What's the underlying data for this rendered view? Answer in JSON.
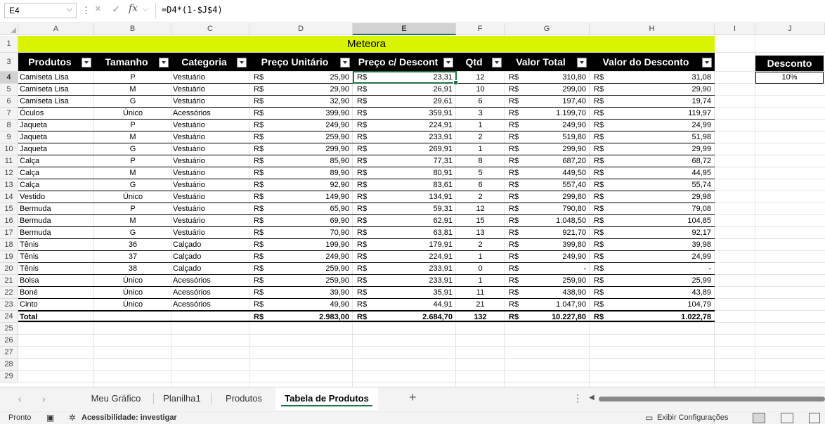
{
  "formula_bar": {
    "name_box": "E4",
    "cancel_icon": "×",
    "enter_icon": "✓",
    "fx_label": "fx",
    "formula": "=D4*(1-$J$4)"
  },
  "columns": [
    "A",
    "B",
    "C",
    "D",
    "E",
    "F",
    "G",
    "H",
    "I",
    "J"
  ],
  "row_numbers": [
    "1",
    "3",
    "4",
    "5",
    "6",
    "7",
    "8",
    "9",
    "10",
    "11",
    "12",
    "13",
    "14",
    "15",
    "16",
    "17",
    "18",
    "19",
    "20",
    "21",
    "22",
    "23",
    "24",
    "25",
    "26",
    "27",
    "28",
    "29"
  ],
  "title": "Meteora",
  "table_headers": [
    "Produtos",
    "Tamanho",
    "Categoria",
    "Preço Unitário",
    "Preço c/ Descont",
    "Qtd",
    "Valor Total",
    "Valor do Desconto"
  ],
  "currency": "R$",
  "rows": [
    {
      "produto": "Camiseta Lisa",
      "tamanho": "P",
      "categoria": "Vestuário",
      "preco": "25,90",
      "preco_desc": "23,31",
      "qtd": "12",
      "total": "310,80",
      "desconto": "31,08"
    },
    {
      "produto": "Camiseta Lisa",
      "tamanho": "M",
      "categoria": "Vestuário",
      "preco": "29,90",
      "preco_desc": "26,91",
      "qtd": "10",
      "total": "299,00",
      "desconto": "29,90"
    },
    {
      "produto": "Camiseta Lisa",
      "tamanho": "G",
      "categoria": "Vestuário",
      "preco": "32,90",
      "preco_desc": "29,61",
      "qtd": "6",
      "total": "197,40",
      "desconto": "19,74"
    },
    {
      "produto": "Óculos",
      "tamanho": "Único",
      "categoria": "Acessórios",
      "preco": "399,90",
      "preco_desc": "359,91",
      "qtd": "3",
      "total": "1.199,70",
      "desconto": "119,97"
    },
    {
      "produto": "Jaqueta",
      "tamanho": "P",
      "categoria": "Vestuário",
      "preco": "249,90",
      "preco_desc": "224,91",
      "qtd": "1",
      "total": "249,90",
      "desconto": "24,99"
    },
    {
      "produto": "Jaqueta",
      "tamanho": "M",
      "categoria": "Vestuário",
      "preco": "259,90",
      "preco_desc": "233,91",
      "qtd": "2",
      "total": "519,80",
      "desconto": "51,98"
    },
    {
      "produto": "Jaqueta",
      "tamanho": "G",
      "categoria": "Vestuário",
      "preco": "299,90",
      "preco_desc": "269,91",
      "qtd": "1",
      "total": "299,90",
      "desconto": "29,99"
    },
    {
      "produto": "Calça",
      "tamanho": "P",
      "categoria": "Vestuário",
      "preco": "85,90",
      "preco_desc": "77,31",
      "qtd": "8",
      "total": "687,20",
      "desconto": "68,72"
    },
    {
      "produto": "Calça",
      "tamanho": "M",
      "categoria": "Vestuário",
      "preco": "89,90",
      "preco_desc": "80,91",
      "qtd": "5",
      "total": "449,50",
      "desconto": "44,95"
    },
    {
      "produto": "Calça",
      "tamanho": "G",
      "categoria": "Vestuário",
      "preco": "92,90",
      "preco_desc": "83,61",
      "qtd": "6",
      "total": "557,40",
      "desconto": "55,74"
    },
    {
      "produto": "Vestido",
      "tamanho": "Único",
      "categoria": "Vestuário",
      "preco": "149,90",
      "preco_desc": "134,91",
      "qtd": "2",
      "total": "299,80",
      "desconto": "29,98"
    },
    {
      "produto": "Bermuda",
      "tamanho": "P",
      "categoria": "Vestuário",
      "preco": "65,90",
      "preco_desc": "59,31",
      "qtd": "12",
      "total": "790,80",
      "desconto": "79,08"
    },
    {
      "produto": "Bermuda",
      "tamanho": "M",
      "categoria": "Vestuário",
      "preco": "69,90",
      "preco_desc": "62,91",
      "qtd": "15",
      "total": "1.048,50",
      "desconto": "104,85"
    },
    {
      "produto": "Bermuda",
      "tamanho": "G",
      "categoria": "Vestuário",
      "preco": "70,90",
      "preco_desc": "63,81",
      "qtd": "13",
      "total": "921,70",
      "desconto": "92,17"
    },
    {
      "produto": "Tênis",
      "tamanho": "36",
      "categoria": "Calçado",
      "preco": "199,90",
      "preco_desc": "179,91",
      "qtd": "2",
      "total": "399,80",
      "desconto": "39,98"
    },
    {
      "produto": "Tênis",
      "tamanho": "37",
      "categoria": "Calçado",
      "preco": "249,90",
      "preco_desc": "224,91",
      "qtd": "1",
      "total": "249,90",
      "desconto": "24,99"
    },
    {
      "produto": "Tênis",
      "tamanho": "38",
      "categoria": "Calçado",
      "preco": "259,90",
      "preco_desc": "233,91",
      "qtd": "0",
      "total": "-",
      "desconto": "-"
    },
    {
      "produto": "Bolsa",
      "tamanho": "Único",
      "categoria": "Acessórios",
      "preco": "259,90",
      "preco_desc": "233,91",
      "qtd": "1",
      "total": "259,90",
      "desconto": "25,99"
    },
    {
      "produto": "Boné",
      "tamanho": "Único",
      "categoria": "Acessórios",
      "preco": "39,90",
      "preco_desc": "35,91",
      "qtd": "11",
      "total": "438,90",
      "desconto": "43,89"
    },
    {
      "produto": "Cinto",
      "tamanho": "Único",
      "categoria": "Acessórios",
      "preco": "49,90",
      "preco_desc": "44,91",
      "qtd": "21",
      "total": "1.047,90",
      "desconto": "104,79"
    }
  ],
  "total": {
    "label": "Total",
    "preco": "2.983,00",
    "preco_desc": "2.684,70",
    "qtd": "132",
    "total": "10.227,80",
    "desconto": "1.022,78"
  },
  "discount": {
    "header": "Desconto",
    "value": "10%"
  },
  "sheet_tabs": [
    {
      "label": "Meu Gráfico",
      "active": false
    },
    {
      "label": "Planilha1",
      "active": false
    },
    {
      "label": "Produtos",
      "active": false
    },
    {
      "label": "Tabela de Produtos",
      "active": true
    }
  ],
  "add_sheet_label": "+",
  "status": {
    "ready": "Pronto",
    "accessibility": "Acessibilidade: investigar",
    "display_settings": "Exibir Configurações"
  },
  "colors": {
    "title_band": "#d9f400",
    "header_bg": "#000000",
    "selection": "#217346"
  }
}
